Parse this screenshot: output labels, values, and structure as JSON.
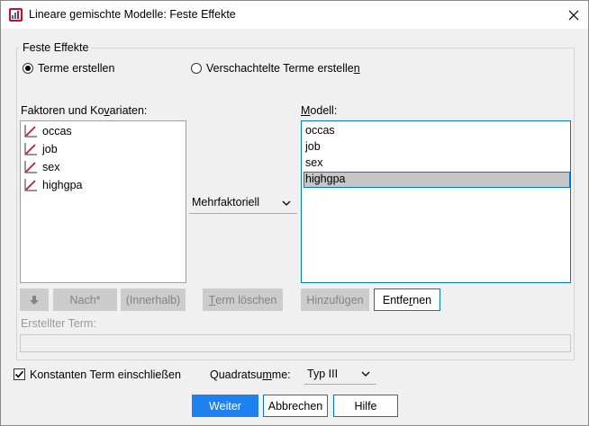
{
  "window": {
    "title": "Lineare gemischte Modelle: Feste Effekte",
    "close_label": "×"
  },
  "fixed_effects": {
    "group_label": "Feste Effekte",
    "radio_build_terms": {
      "label": "Terme erstellen",
      "checked": true
    },
    "radio_nested_terms": {
      "label_pre": "Verschachtelte Terme erstelle",
      "label_u": "n",
      "checked": false
    }
  },
  "factors": {
    "label_pre": "Faktoren und Ko",
    "label_u": "v",
    "label_post": "ariaten:",
    "items": [
      {
        "label": "occas",
        "icon": "scale-variable-icon"
      },
      {
        "label": "job",
        "icon": "scale-variable-icon"
      },
      {
        "label": "sex",
        "icon": "scale-variable-icon"
      },
      {
        "label": "highgpa",
        "icon": "scale-variable-icon"
      }
    ]
  },
  "build": {
    "type_selected": "Mehrfaktoriell"
  },
  "model": {
    "label_u": "M",
    "label_post": "odell:",
    "items": [
      "occas",
      "job",
      "sex",
      "highgpa"
    ],
    "selected_index": 3
  },
  "buttons": {
    "by_arrow": "arrow-down-icon",
    "nach": "Nach*",
    "innerhalb": "(Innerhalb)",
    "term_loeschen_u": "T",
    "term_loeschen_post": "erm löschen",
    "hinzufuegen": "Hinzufügen",
    "entfernen_pre": "Entfe",
    "entfernen_u": "r",
    "entfernen_post": "nen"
  },
  "built_term": {
    "label": "Erstellter Term:",
    "value": ""
  },
  "options": {
    "include_intercept": {
      "label": "Konstanten Term einschließen",
      "checked": true
    },
    "sum_of_squares_label_pre": "Quadratsu",
    "sum_of_squares_label_u": "m",
    "sum_of_squares_label_post": "me:",
    "sum_of_squares_value": "Typ III"
  },
  "footer": {
    "continue": "Weiter",
    "cancel": "Abbrechen",
    "help": "Hilfe"
  },
  "colors": {
    "accent": "#0078d7",
    "primary_button": "#1f80ef",
    "selection": "#c6c6c6"
  }
}
